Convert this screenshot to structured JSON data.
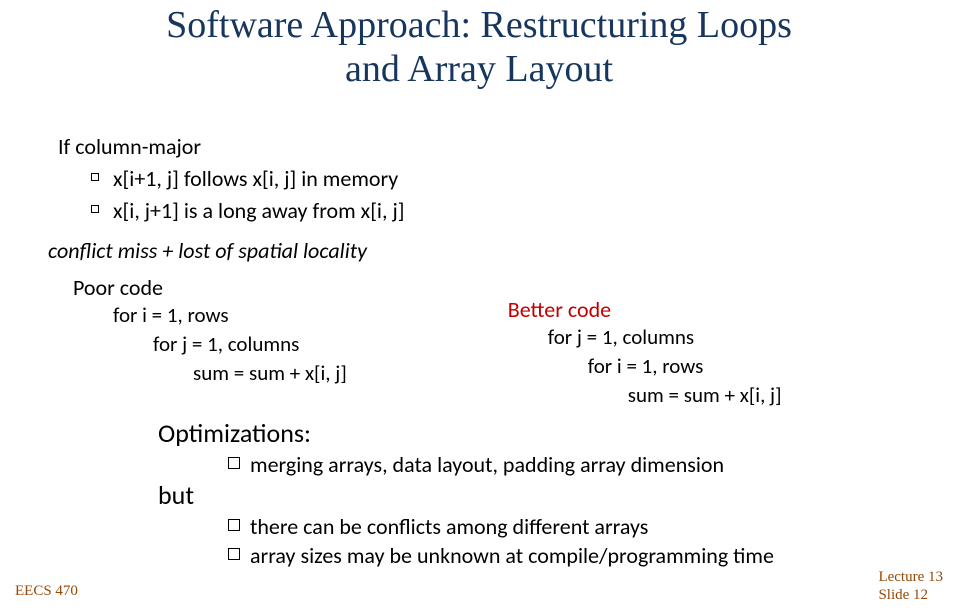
{
  "title_line1": "Software Approach: Restructuring Loops",
  "title_line2": "and Array Layout",
  "intro": "If column-major",
  "bullets": [
    "x[i+1, j] follows x[i, j] in memory",
    "x[i, j+1] is a long away from x[i, j]"
  ],
  "conflict": "conflict miss + lost of spatial locality",
  "poor": {
    "head": "Poor code",
    "l1": "for i = 1, rows",
    "l2": "for j = 1, columns",
    "l3": "sum = sum + x[i, j]"
  },
  "better": {
    "head": "Better code",
    "l1": "for j = 1, columns",
    "l2": "for i = 1, rows",
    "l3": "sum = sum + x[i, j]"
  },
  "opt_head": "Optimizations:",
  "opt_item": "merging arrays, data layout, padding array dimension",
  "but": "but",
  "conf1": "there can be conflicts among different arrays",
  "conf2": "array sizes may be unknown at compile/programming time",
  "footer_course": "EECS 470",
  "footer_lecture": "Lecture 13",
  "footer_slide": "Slide 12"
}
